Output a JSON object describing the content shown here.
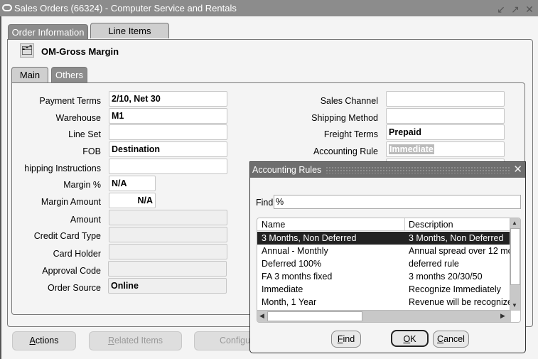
{
  "window": {
    "title": "Sales Orders (66324) - Computer Service and Rentals",
    "controls": [
      "minimize-icon",
      "maximize-icon",
      "close-icon"
    ]
  },
  "tabs": [
    {
      "label": "Order Information",
      "active": true
    },
    {
      "label": "Line Items",
      "active": false
    }
  ],
  "header": {
    "title": "OM-Gross Margin",
    "icon": "folder-open-icon"
  },
  "subtabs": [
    {
      "label": "Main",
      "active": false
    },
    {
      "label": "Others",
      "active": true
    }
  ],
  "left_fields": [
    {
      "label": "Payment Terms",
      "value": "2/10, Net 30"
    },
    {
      "label": "Warehouse",
      "value": "M1"
    },
    {
      "label": "Line Set",
      "value": ""
    },
    {
      "label": "FOB",
      "value": "Destination"
    },
    {
      "label": "hipping Instructions",
      "value": ""
    },
    {
      "label": "Margin %",
      "value": "N/A"
    },
    {
      "label": "Margin Amount",
      "value": "N/A"
    },
    {
      "label": "Amount",
      "value": ""
    },
    {
      "label": "Credit Card Type",
      "value": ""
    },
    {
      "label": "Card Holder",
      "value": ""
    },
    {
      "label": "Approval Code",
      "value": ""
    },
    {
      "label": "Order Source",
      "value": "Online"
    }
  ],
  "right_fields": [
    {
      "label": "Sales Channel",
      "value": ""
    },
    {
      "label": "Shipping Method",
      "value": ""
    },
    {
      "label": "Freight Terms",
      "value": "Prepaid"
    },
    {
      "label": "Accounting Rule",
      "value": "Immediate"
    }
  ],
  "buttons": {
    "actions": "Actions",
    "related_items": "Related Items",
    "configure": "Configu"
  },
  "dialog": {
    "title": "Accounting Rules",
    "find_label": "Find",
    "find_value": "%",
    "columns": [
      "Name",
      "Description"
    ],
    "rows": [
      {
        "name": "3 Months, Non Deferred",
        "description": "3 Months, Non Deferred",
        "selected": true
      },
      {
        "name": "Annual - Monthly",
        "description": "Annual spread over 12 mo",
        "selected": false
      },
      {
        "name": "Deferred 100%",
        "description": "deferred rule",
        "selected": false
      },
      {
        "name": "FA 3 months fixed",
        "description": "3 months 20/30/50",
        "selected": false
      },
      {
        "name": "Immediate",
        "description": "Recognize Immediately",
        "selected": false
      },
      {
        "name": "Month, 1 Year",
        "description": "Revenue will be recognize",
        "selected": false
      }
    ],
    "buttons": {
      "find": "Find",
      "ok": "OK",
      "cancel": "Cancel"
    }
  }
}
